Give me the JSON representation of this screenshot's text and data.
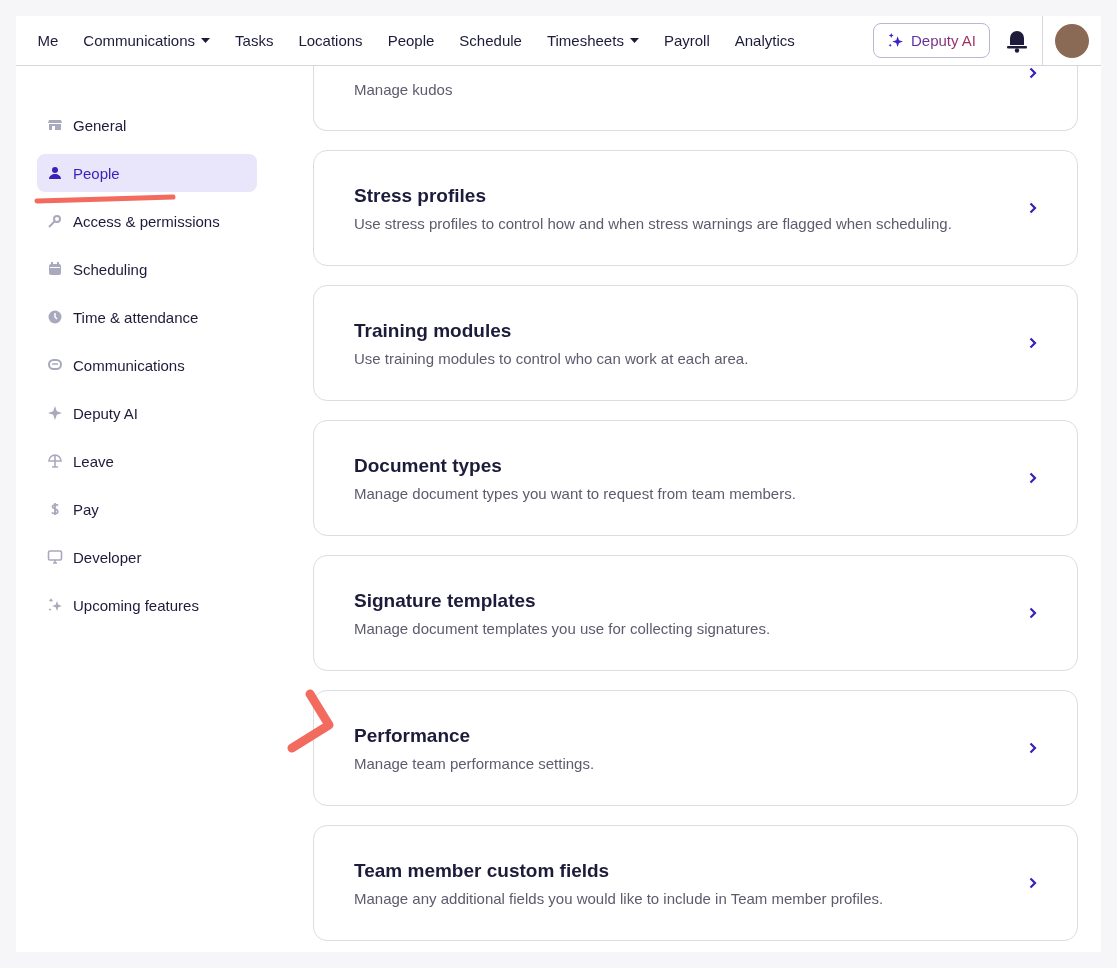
{
  "nav": [
    {
      "label": "Me",
      "dropdown": false
    },
    {
      "label": "Communications",
      "dropdown": true
    },
    {
      "label": "Tasks",
      "dropdown": false
    },
    {
      "label": "Locations",
      "dropdown": false
    },
    {
      "label": "People",
      "dropdown": false
    },
    {
      "label": "Schedule",
      "dropdown": false
    },
    {
      "label": "Timesheets",
      "dropdown": true
    },
    {
      "label": "Payroll",
      "dropdown": false
    },
    {
      "label": "Analytics",
      "dropdown": false
    }
  ],
  "ai_button": {
    "label": "Deputy AI"
  },
  "sidebar": {
    "items": [
      {
        "label": "General",
        "selected": false,
        "underlined": false
      },
      {
        "label": "People",
        "selected": true,
        "underlined": true
      },
      {
        "label": "Access & permissions",
        "selected": false,
        "underlined": false
      },
      {
        "label": "Scheduling",
        "selected": false,
        "underlined": false
      },
      {
        "label": "Time & attendance",
        "selected": false,
        "underlined": false
      },
      {
        "label": "Communications",
        "selected": false,
        "underlined": false
      },
      {
        "label": "Deputy AI",
        "selected": false,
        "underlined": false
      },
      {
        "label": "Leave",
        "selected": false,
        "underlined": false
      },
      {
        "label": "Pay",
        "selected": false,
        "underlined": false
      },
      {
        "label": "Developer",
        "selected": false,
        "underlined": false
      },
      {
        "label": "Upcoming features",
        "selected": false,
        "underlined": false
      }
    ]
  },
  "cards": [
    {
      "description": "Manage kudos",
      "pointed": false
    },
    {
      "title": "Stress profiles",
      "description": "Use stress profiles to control how and when stress warnings are flagged when scheduling.",
      "pointed": false
    },
    {
      "title": "Training modules",
      "description": "Use training modules to control who can work at each area.",
      "pointed": false
    },
    {
      "title": "Document types",
      "description": "Manage document types you want to request from team members.",
      "pointed": false
    },
    {
      "title": "Signature templates",
      "description": "Manage document templates you use for collecting signatures.",
      "pointed": false
    },
    {
      "title": "Performance",
      "description": "Manage team performance settings.",
      "pointed": true
    },
    {
      "title": "Team member custom fields",
      "description": "Manage any additional fields you would like to include in Team member profiles.",
      "pointed": false
    }
  ]
}
